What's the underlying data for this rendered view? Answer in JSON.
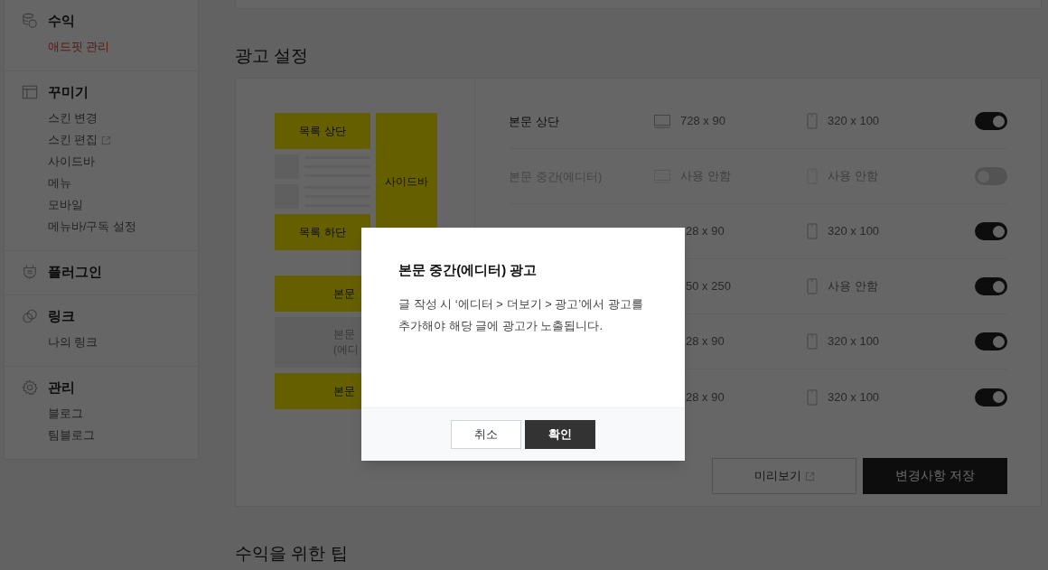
{
  "sidebar": {
    "sections": [
      {
        "kind": "coins",
        "title": "수익",
        "items": [
          {
            "label": "애드핏 관리",
            "selected": true,
            "external": false
          }
        ]
      },
      {
        "kind": "layout",
        "title": "꾸미기",
        "items": [
          {
            "label": "스킨 변경",
            "selected": false,
            "external": false
          },
          {
            "label": "스킨 편집",
            "selected": false,
            "external": true
          },
          {
            "label": "사이드바",
            "selected": false,
            "external": false
          },
          {
            "label": "메뉴",
            "selected": false,
            "external": false
          },
          {
            "label": "모바일",
            "selected": false,
            "external": false
          },
          {
            "label": "메뉴바/구독 설정",
            "selected": false,
            "external": false
          }
        ]
      },
      {
        "kind": "plug",
        "title": "플러그인"
      },
      {
        "kind": "link",
        "title": "링크",
        "items": [
          {
            "label": "나의 링크",
            "selected": false,
            "external": false
          }
        ]
      },
      {
        "kind": "gear",
        "title": "관리",
        "items": [
          {
            "label": "블로그",
            "selected": false,
            "external": false
          },
          {
            "label": "팀블로그",
            "selected": false,
            "external": false
          }
        ]
      }
    ]
  },
  "ad_settings": {
    "title": "광고 설정",
    "preview": {
      "list_top": "목록 상단",
      "list_bottom": "목록 하단",
      "sidebar": "사이드바",
      "body_top": "본문",
      "body_middle": [
        "본문",
        "(에디"
      ],
      "body_bottom": "본문"
    },
    "rows": [
      {
        "label": "본문 상단",
        "desktop": "728 x 90",
        "mobile": "320 x 100",
        "on": true,
        "disabled": false
      },
      {
        "label": "본문 중간(에디터)",
        "desktop": "사용 안함",
        "mobile": "사용 안함",
        "on": false,
        "disabled": true
      },
      {
        "desktop": "28 x 90",
        "mobile": "320 x 100",
        "on": true,
        "disabled": false
      },
      {
        "desktop": "50 x 250",
        "mobile": "사용 안함",
        "on": true,
        "disabled": false
      },
      {
        "desktop": "28 x 90",
        "mobile": "320 x 100",
        "on": true,
        "disabled": false
      },
      {
        "desktop": "28 x 90",
        "mobile": "320 x 100",
        "on": true,
        "disabled": false
      }
    ],
    "preview_button": "미리보기",
    "save_button": "변경사항 저장"
  },
  "tips": {
    "title": "수익을 위한 팁"
  },
  "dialog": {
    "title": "본문 중간(에디터) 광고",
    "message": "글 작성 시 ‘에디터 > 더보기 > 광고’에서 광고를 추가해야 해당 글에 광고가 노출됩니다.",
    "cancel": "취소",
    "confirm": "확인"
  }
}
